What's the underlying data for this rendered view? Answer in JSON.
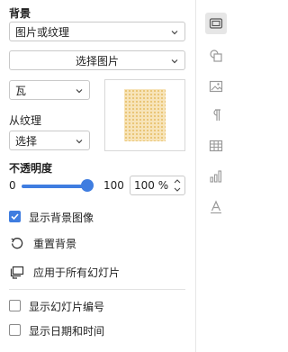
{
  "background": {
    "heading": "背景",
    "fill_type": "图片或纹理",
    "choose_picture": "选择图片",
    "tile_mode": "瓦",
    "from_texture_label": "从纹理",
    "texture_select": "选择",
    "opacity_label": "不透明度",
    "opacity_min": "0",
    "opacity_max": "100",
    "opacity_value": "100 %",
    "opacity_fraction": 1.0,
    "show_background_graphics": "显示背景图像",
    "show_background_graphics_checked": true,
    "reset_background": "重置背景",
    "apply_to_all": "应用于所有幻灯片",
    "show_slide_number": "显示幻灯片编号",
    "show_slide_number_checked": false,
    "show_date_time": "显示日期和时间",
    "show_date_time_checked": false
  },
  "rail": {
    "items": [
      "slide-settings-icon",
      "shape-settings-icon",
      "image-settings-icon",
      "paragraph-settings-icon",
      "table-settings-icon",
      "chart-settings-icon",
      "text-art-settings-icon"
    ],
    "active": "slide-settings-icon"
  },
  "colors": {
    "accent": "#3f7de0",
    "texture": "#f7e4b9"
  }
}
